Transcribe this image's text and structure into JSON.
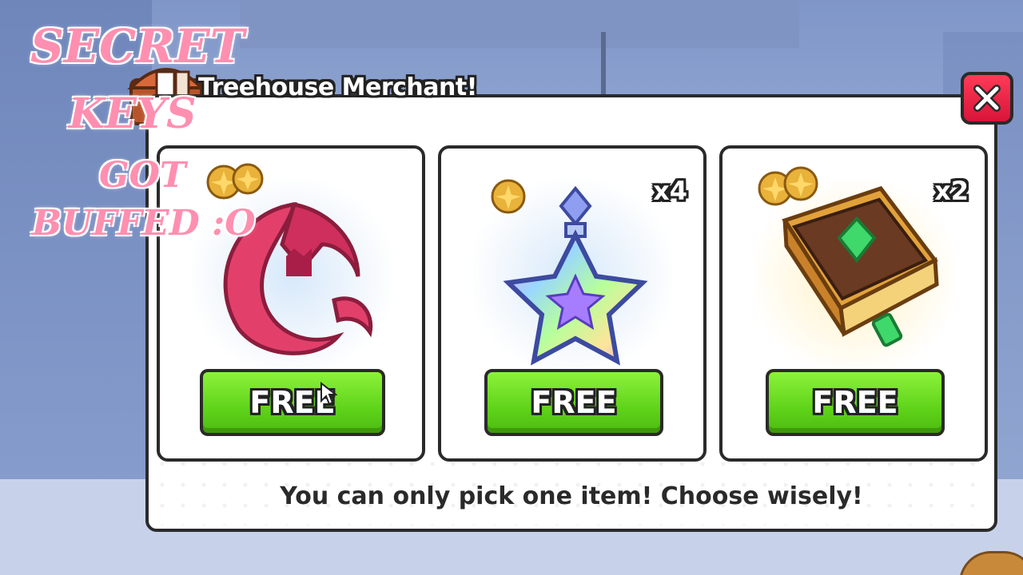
{
  "merchant": {
    "title": "Treehouse Merchant!",
    "close_icon": "close-icon",
    "footer": "You can only pick one item! Choose wisely!"
  },
  "items": [
    {
      "art": "pink-crescent-charm-icon",
      "quantity": "",
      "button_label": "FREE"
    },
    {
      "art": "rainbow-star-potion-icon",
      "quantity": "x4",
      "button_label": "FREE"
    },
    {
      "art": "green-gem-spellbook-icon",
      "quantity": "x2",
      "button_label": "FREE"
    }
  ],
  "overlay_text": {
    "line1": "SECRET",
    "line2": "KEYS",
    "line3": "GOT",
    "line4": "BUFFED :O"
  },
  "colors": {
    "button_green": "#5fd41a",
    "close_red": "#e81f45",
    "overlay_pink": "#ff8fb0"
  }
}
